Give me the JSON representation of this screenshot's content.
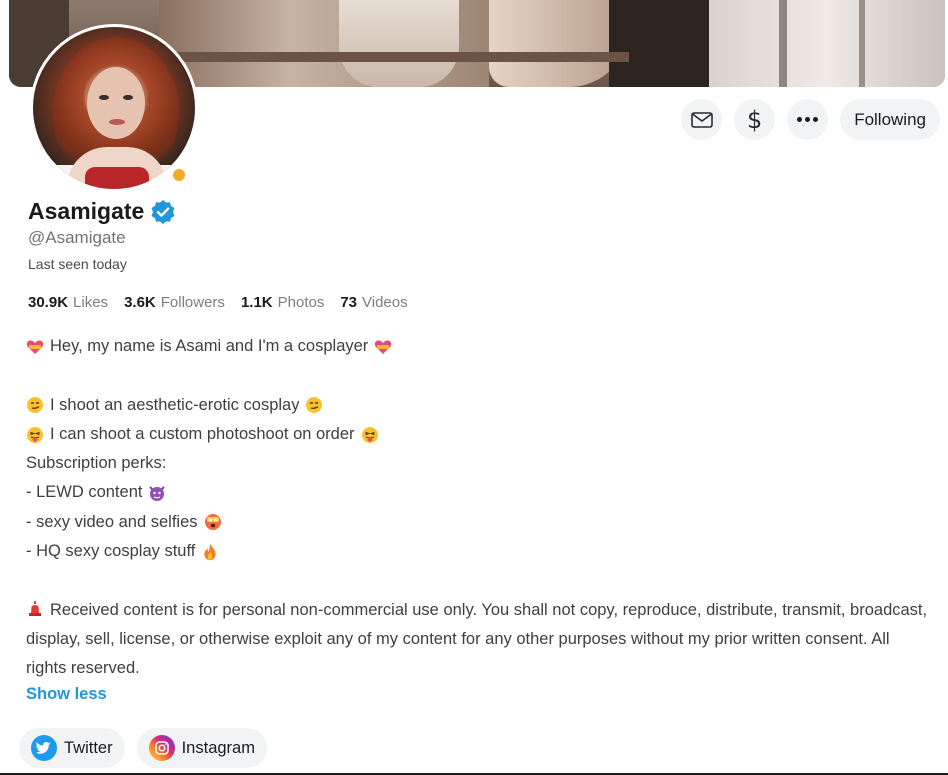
{
  "profile": {
    "name": "Asamigate",
    "handle": "@Asamigate",
    "last_seen": "Last seen today",
    "online_color": "#f9a72b",
    "verified_color": "#2196d8"
  },
  "actions": {
    "message_icon": "envelope-icon",
    "tip_icon": "dollar-icon",
    "tip_label": "$",
    "more_icon": "more-dots-icon",
    "follow_label": "Following"
  },
  "stats": [
    {
      "value": "30.9K",
      "label": "Likes"
    },
    {
      "value": "3.6K",
      "label": "Followers"
    },
    {
      "value": "1.1K",
      "label": "Photos"
    },
    {
      "value": "73",
      "label": "Videos"
    }
  ],
  "bio": {
    "line1": "Hey, my name is Asami and I'm a cosplayer",
    "line2": "I shoot an aesthetic-erotic cosplay",
    "line3": "I can shoot a custom photoshoot on order",
    "line4": "Subscription perks:",
    "line5": "- LEWD content",
    "line6": "- sexy video and selfies",
    "line7": "- HQ sexy cosplay stuff",
    "notice": "Received content is for personal non-commercial use only. You shall not copy, reproduce, distribute, transmit, broadcast, display, sell, license, or otherwise exploit any of my content for any other purposes without my prior written consent. All rights reserved."
  },
  "show_less": "Show less",
  "socials": [
    {
      "label": "Twitter",
      "icon": "twitter-icon",
      "color": "#1d9bf0"
    },
    {
      "label": "Instagram",
      "icon": "instagram-icon",
      "color": "#d62976"
    }
  ],
  "emojis": {
    "heart": "heart-emoji-icon",
    "smirk": "smirk-emoji-icon",
    "tongue": "tongue-emoji-icon",
    "devil": "devil-emoji-icon",
    "shocked": "shocked-emoji-icon",
    "fire": "fire-emoji-icon",
    "siren": "siren-emoji-icon"
  }
}
